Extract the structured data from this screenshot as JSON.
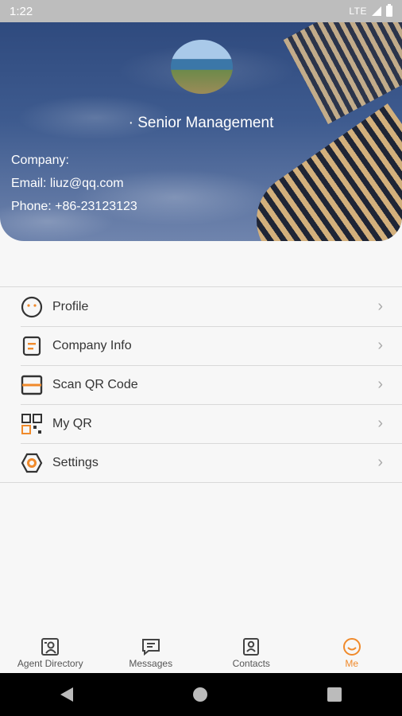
{
  "status_bar": {
    "time": "1:22",
    "network": "LTE"
  },
  "profile": {
    "role": "· Senior Management",
    "company": "Company:",
    "email": "Email: liuz@qq.com",
    "phone": "Phone: +86-23123123"
  },
  "menu": {
    "items": [
      {
        "label": "Profile",
        "icon": "face-icon"
      },
      {
        "label": "Company Info",
        "icon": "document-icon"
      },
      {
        "label": "Scan QR Code",
        "icon": "scan-icon"
      },
      {
        "label": "My QR",
        "icon": "qr-icon"
      },
      {
        "label": "Settings",
        "icon": "gear-icon"
      }
    ]
  },
  "bottom_nav": {
    "items": [
      {
        "label": "Agent Directory",
        "icon": "directory-icon",
        "active": false
      },
      {
        "label": "Messages",
        "icon": "message-icon",
        "active": false
      },
      {
        "label": "Contacts",
        "icon": "contacts-icon",
        "active": false
      },
      {
        "label": "Me",
        "icon": "smile-icon",
        "active": true
      }
    ]
  },
  "colors": {
    "accent": "#f08a2b",
    "icon_dark": "#333333"
  }
}
